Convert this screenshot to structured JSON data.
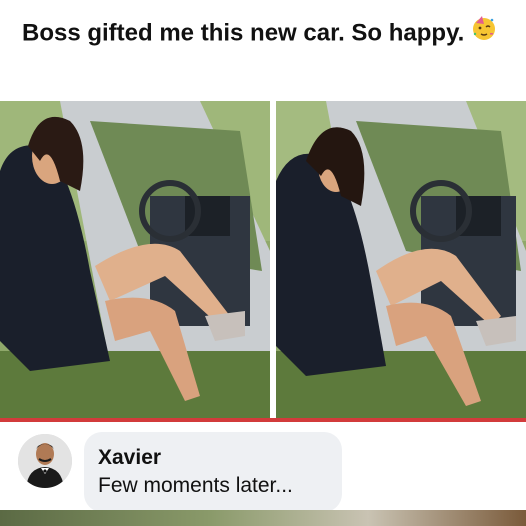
{
  "post": {
    "caption": "Boss gifted me this new car. So happy.",
    "emoji_icon": "partying-face-icon"
  },
  "photos": {
    "count": 2
  },
  "comment": {
    "author": "Xavier",
    "text": "Few moments later..."
  },
  "colors": {
    "divider": "#d23b3b",
    "bubble": "#eef0f3",
    "jacket": "#1a1f2b"
  }
}
